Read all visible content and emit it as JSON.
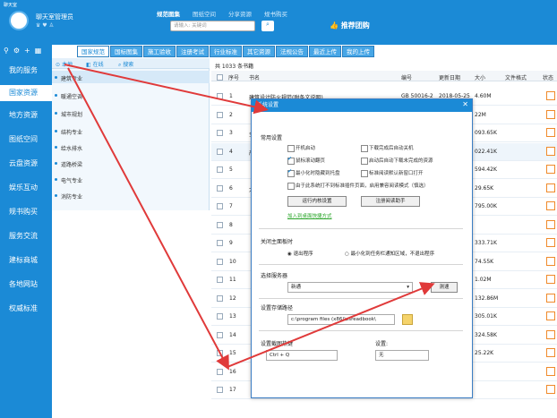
{
  "window": {
    "title": "聊天室",
    "app_name": "聊天室管理员",
    "search_placeholder": "请输入: 关键词",
    "nav": [
      "规范图集",
      "图纸空间",
      "分享资源",
      "规书购买"
    ],
    "promo": "推荐团购"
  },
  "sidebar": {
    "items": [
      "我的服务",
      "国家资源",
      "地方资源",
      "图纸空间",
      "云盘资源",
      "娱乐互动",
      "规书购买",
      "服务交流",
      "建标商城",
      "各地网站",
      "权威标准"
    ]
  },
  "tabs": [
    "国家规范",
    "国标图集",
    "施工验收",
    "注册考试",
    "行业标准",
    "其它资源",
    "法规公告",
    "最近上传",
    "我的上传"
  ],
  "category": {
    "toolbar": [
      "本地",
      "在线",
      "搜索"
    ],
    "items": [
      "建筑专业",
      "暖通空调",
      "城市规划",
      "结构专业",
      "给水排水",
      "道路桥梁",
      "电气专业",
      "消防专业"
    ]
  },
  "table": {
    "count_label": "共 1033 条书籍",
    "headers": [
      "序号",
      "书名",
      "编号",
      "更新日期",
      "大小",
      "文件格式",
      "状态"
    ],
    "rows": [
      {
        "no": "1",
        "name": "建筑设计防火规范(附条文说明)",
        "code": "GB 50016-2",
        "date": "2018-05-25",
        "size": "4.60M"
      },
      {
        "no": "2",
        "name": "",
        "code": "",
        "date": "",
        "size": "22M"
      },
      {
        "no": "3",
        "name": "全",
        "code": "",
        "date": "",
        "size": "093.65K"
      },
      {
        "no": "4",
        "name": "严",
        "code": "",
        "date": "",
        "size": "022.41K"
      },
      {
        "no": "5",
        "name": "",
        "code": "",
        "date": "",
        "size": "594.42K"
      },
      {
        "no": "6",
        "name": "大",
        "code": "",
        "date": "",
        "size": "29.65K"
      },
      {
        "no": "7",
        "name": "",
        "code": "",
        "date": "",
        "size": "795.00K"
      },
      {
        "no": "8",
        "name": "",
        "code": "",
        "date": "",
        "size": "",
        "hidden": true
      },
      {
        "no": "9",
        "name": "",
        "code": "",
        "date": "",
        "size": "333.71K"
      },
      {
        "no": "10",
        "name": "",
        "code": "",
        "date": "",
        "size": "74.55K"
      },
      {
        "no": "11",
        "name": "",
        "code": "",
        "date": "",
        "size": "1.02M"
      },
      {
        "no": "12",
        "name": "",
        "code": "",
        "date": "",
        "size": "132.86M"
      },
      {
        "no": "13",
        "name": "",
        "code": "",
        "date": "",
        "size": "305.01K"
      },
      {
        "no": "14",
        "name": "",
        "code": "",
        "date": "",
        "size": "324.58K"
      },
      {
        "no": "15",
        "name": "",
        "code": "",
        "date": "",
        "size": "25.22K"
      },
      {
        "no": "16",
        "name": "",
        "code": "",
        "date": "",
        "size": ""
      },
      {
        "no": "17",
        "name": "",
        "code": "",
        "date": "",
        "size": ""
      }
    ]
  },
  "dialog": {
    "title": "系统设置",
    "common_title": "常用设置",
    "options": [
      {
        "label": "开机启动",
        "on": false
      },
      {
        "label": "下载完成后自动关机",
        "on": false
      },
      {
        "label": "鼠标滚动翻页",
        "on": true
      },
      {
        "label": "启动后自动下载未完成的资源",
        "on": false
      },
      {
        "label": "最小化时隐藏到托盘",
        "on": true
      },
      {
        "label": "标准阅读默认新窗口打开",
        "on": false
      },
      {
        "label": "由于此系统打不到标准插件页面，启用兼容阅读模式（慎选）",
        "on": false
      }
    ],
    "btn_runtime": "运行内核设置",
    "btn_register": "注册阅读助手",
    "link_text": "加入到桌面快捷方式",
    "close_title": "关闭主面板时",
    "radio_exit": "退出程序",
    "radio_tray": "最小化到任务栏通知区域，不退出程序",
    "server_title": "选择服务器",
    "server_value": "新通",
    "btn_test": "测速",
    "path_title": "设置存储路径",
    "path_value": "c:\\program files (x86)\\zsreadbook\\",
    "hotkey_title": "设置截图热键",
    "hotkey_value": "Ctrl + Q",
    "other_title": "设置:",
    "other_value": "无"
  },
  "colors": {
    "accent": "#1b8ad6",
    "arrow": "#e03a3a"
  }
}
